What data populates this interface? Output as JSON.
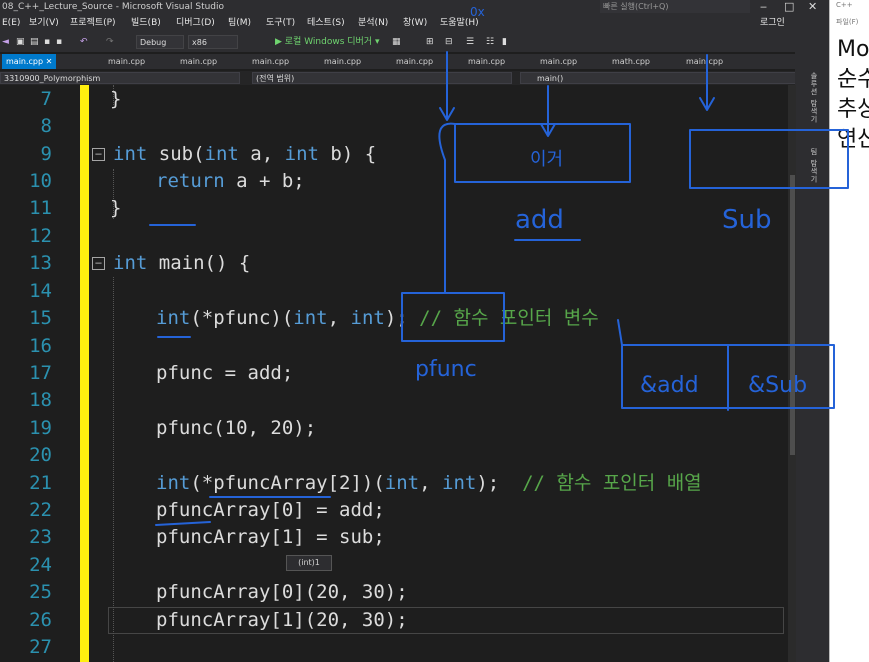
{
  "window": {
    "title": "08_C++_Lecture_Source - Microsoft Visual Studio",
    "search_placeholder": "빠른 실행(Ctrl+Q)",
    "login": "로그인",
    "controls": {
      "min": "‒",
      "max": "□",
      "close": "✕"
    }
  },
  "menu": [
    {
      "label": "E(E)"
    },
    {
      "label": "보기(V)"
    },
    {
      "label": "프로젝트(P)"
    },
    {
      "label": "빌드(B)"
    },
    {
      "label": "디버그(D)"
    },
    {
      "label": "팀(M)"
    },
    {
      "label": "도구(T)"
    },
    {
      "label": "테스트(S)"
    },
    {
      "label": "분석(N)"
    },
    {
      "label": "창(W)"
    },
    {
      "label": "도움말(H)"
    }
  ],
  "toolbar": {
    "config": "Debug",
    "platform": "x86",
    "run_label": "▶ 로컬 Windows 디버거 ▾"
  },
  "tabs": [
    {
      "label": "main.cpp",
      "active": true,
      "close": "✕"
    },
    {
      "label": "main.cpp"
    },
    {
      "label": "main.cpp"
    },
    {
      "label": "main.cpp"
    },
    {
      "label": "main.cpp"
    },
    {
      "label": "main.cpp"
    },
    {
      "label": "main.cpp"
    },
    {
      "label": "main.cpp"
    },
    {
      "label": "math.cpp"
    },
    {
      "label": "main.cpp"
    }
  ],
  "navbar": {
    "project": "3310900_Polymorphism",
    "scope": "(전역 범위)",
    "member": "main()"
  },
  "side_tabs": [
    "솔루션 탐색기",
    "팀 탐색기"
  ],
  "code_lines": [
    {
      "n": "7",
      "text": "}"
    },
    {
      "n": "8",
      "text": ""
    },
    {
      "n": "9",
      "text": "int sub(int a, int b) {"
    },
    {
      "n": "10",
      "text": "return a + b;"
    },
    {
      "n": "11",
      "text": "}"
    },
    {
      "n": "12",
      "text": ""
    },
    {
      "n": "13",
      "text": "int main() {"
    },
    {
      "n": "14",
      "text": ""
    },
    {
      "n": "15",
      "text": "int(*pfunc)(int, int); // 함수 포인터 변수"
    },
    {
      "n": "16",
      "text": ""
    },
    {
      "n": "17",
      "text": "pfunc = add;"
    },
    {
      "n": "18",
      "text": ""
    },
    {
      "n": "19",
      "text": "pfunc(10, 20);"
    },
    {
      "n": "20",
      "text": ""
    },
    {
      "n": "21",
      "text": "int(*pfuncArray[2])(int, int);  // 함수 포인터 배열"
    },
    {
      "n": "22",
      "text": "pfuncArray[0] = add;"
    },
    {
      "n": "23",
      "text": "pfuncArray[1] = sub;"
    },
    {
      "n": "24",
      "text": ""
    },
    {
      "n": "25",
      "text": "pfuncArray[0](20, 30);"
    },
    {
      "n": "26",
      "text": "pfuncArray[1](20, 30);"
    },
    {
      "n": "27",
      "text": ""
    }
  ],
  "code_parts": {
    "l9_kw1": "int",
    "l9_a": " sub(",
    "l9_kw2": "int",
    "l9_b": " a, ",
    "l9_kw3": "int",
    "l9_c": " b) {",
    "l10_kw": "return",
    "l10_rest": " a + b;",
    "l13_kw": "int",
    "l13_rest": " main() {",
    "l15_kw1": "int",
    "l15_a": "(*pfunc)(",
    "l15_kw2": "int",
    "l15_b": ", ",
    "l15_kw3": "int",
    "l15_c": ");",
    "l15_cm": " // 함수 포인터 변수",
    "l21_kw1": "int",
    "l21_a": "(*pfuncArray[2])(",
    "l21_kw2": "int",
    "l21_b": ", ",
    "l21_kw3": "int",
    "l21_c": ");",
    "l21_cm": "  // 함수 포인터 배열"
  },
  "tooltip": "(int)1",
  "right_panel": {
    "lines": [
      "Mo",
      "순수",
      "추상",
      "연산"
    ],
    "menu": "파일(F)",
    "tab": "C++"
  },
  "annotations": {
    "texts": [
      "이거",
      "add",
      "Sub",
      "pfunc",
      "&add",
      "&Sub",
      "0x"
    ],
    "ink_color": "#2563d8"
  },
  "colors": {
    "keyword": "#569cd6",
    "comment": "#57a64a",
    "line_number": "#2b91af",
    "accent": "#007acc",
    "change_bar": "#ffef0f"
  }
}
